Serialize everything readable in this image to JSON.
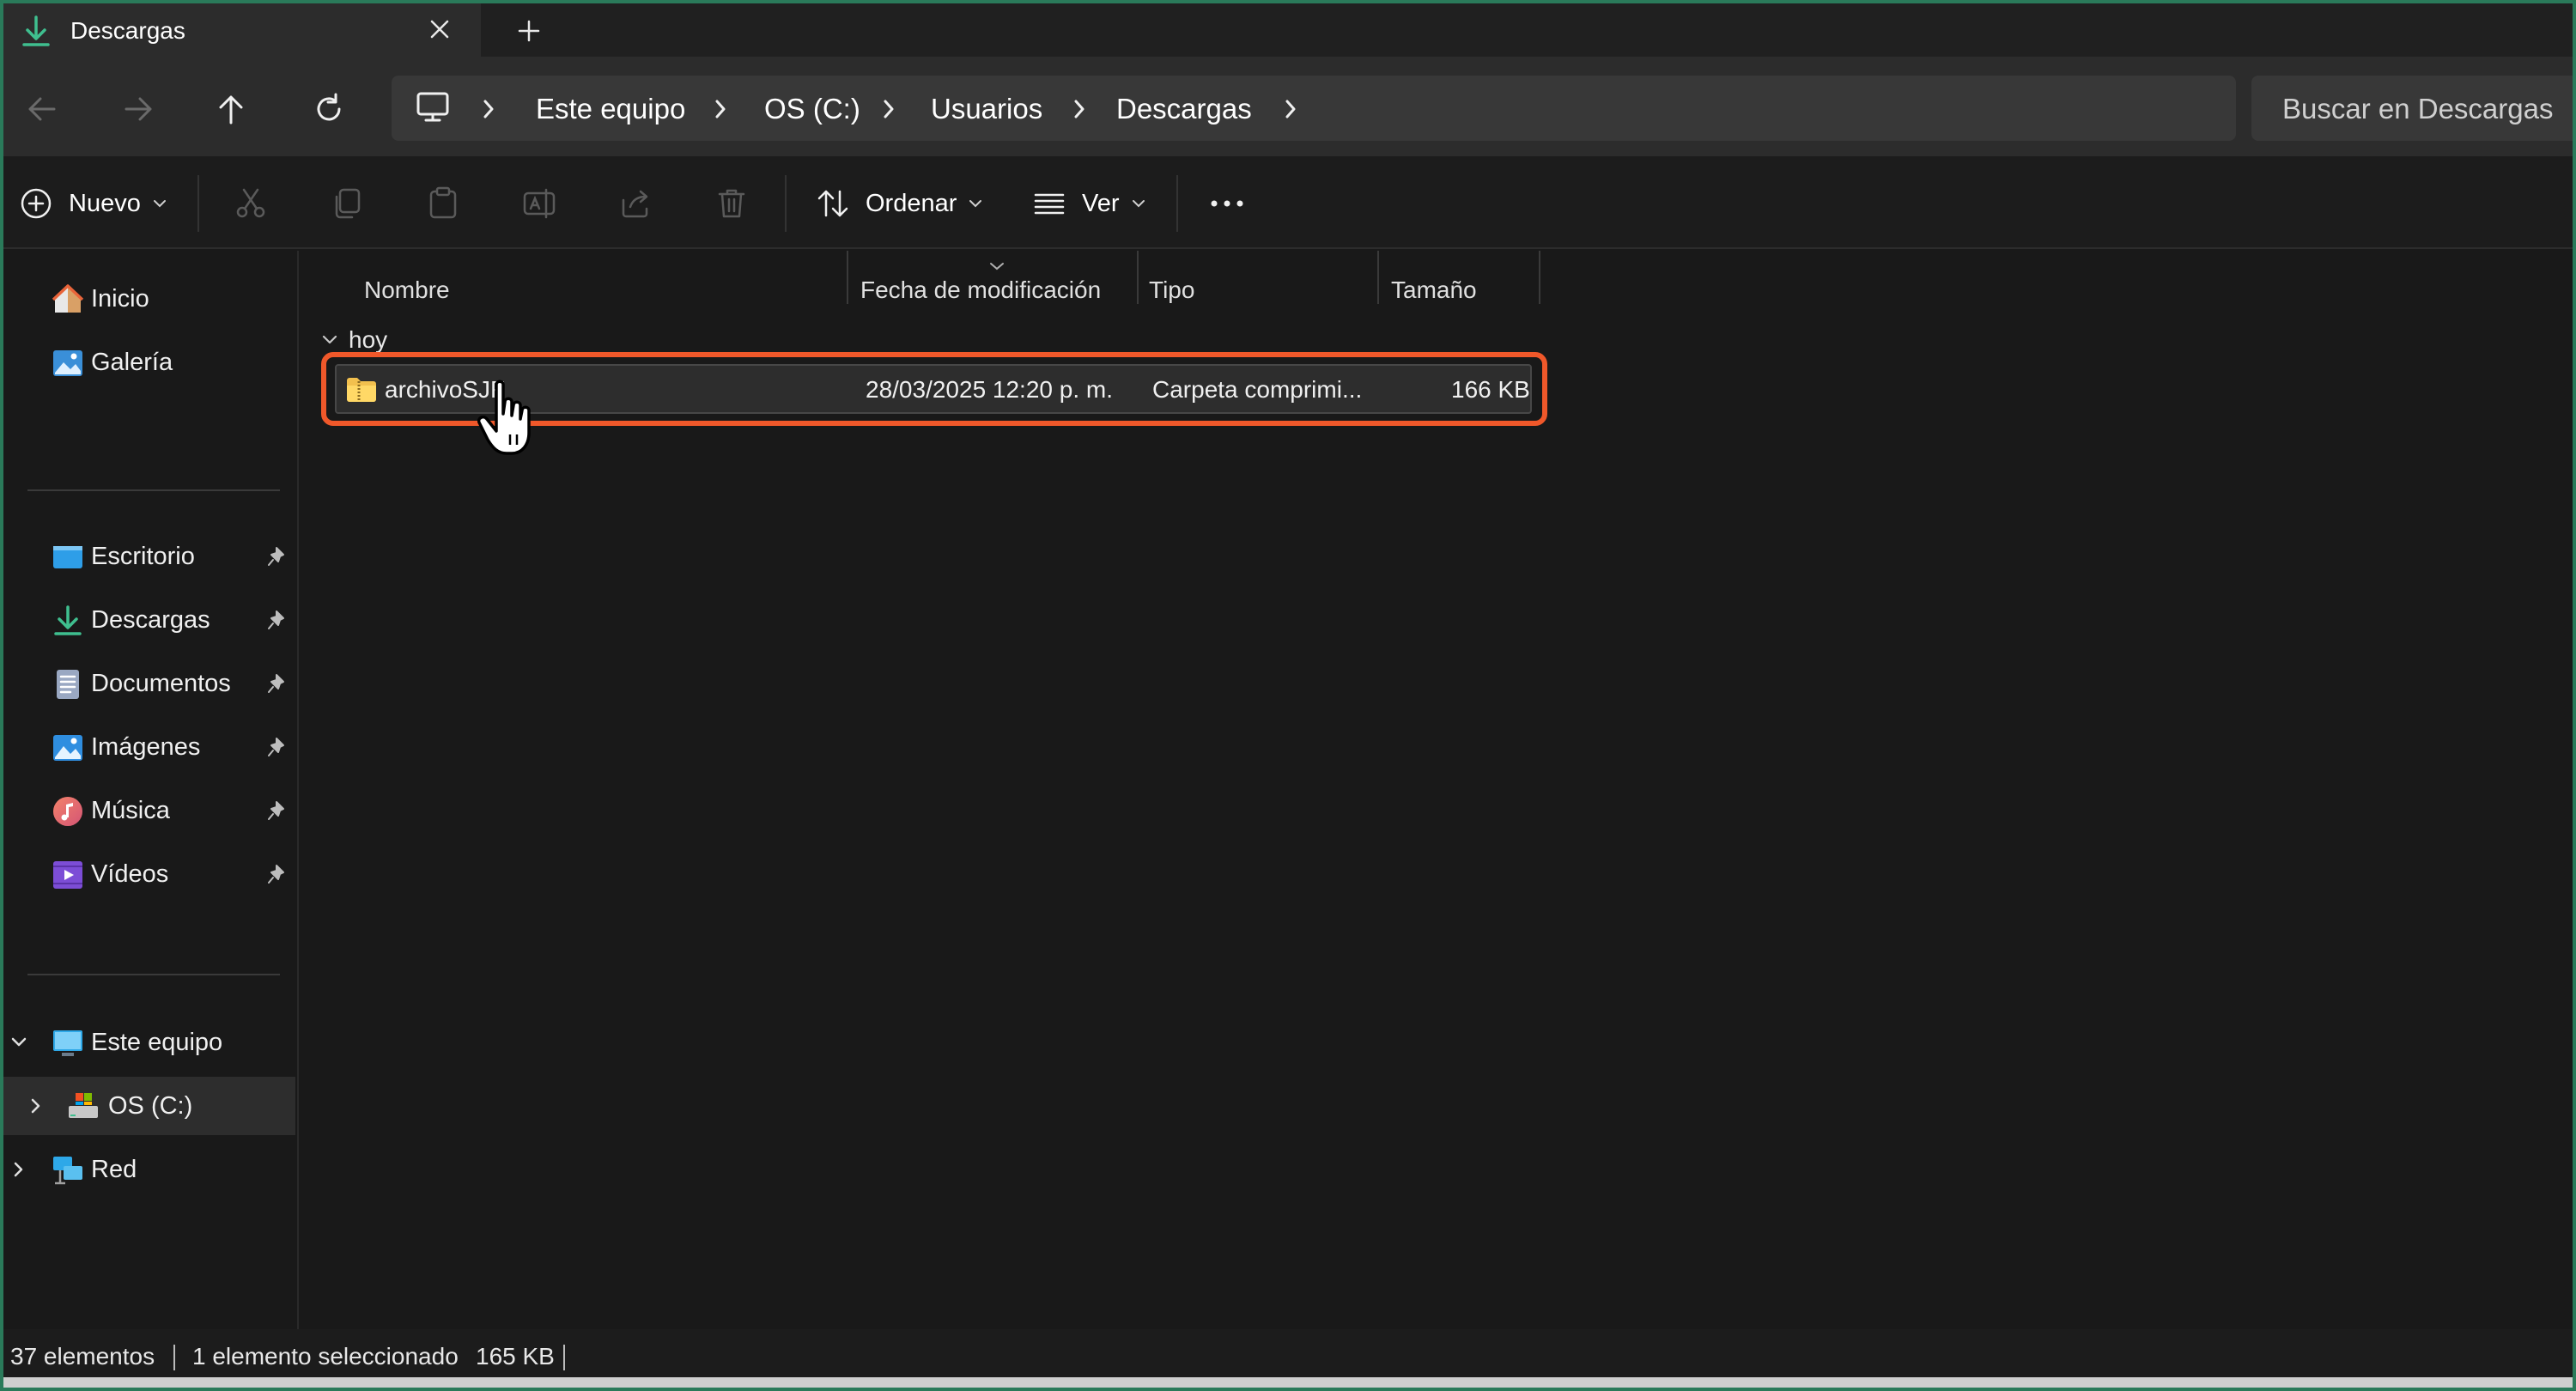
{
  "window": {
    "tab_title": "Descargas",
    "tab_icon": "download-icon"
  },
  "addressbar": {
    "crumbs": [
      "Este equipo",
      "OS (C:)",
      "Usuarios",
      "Descargas"
    ],
    "search_placeholder": "Buscar en Descargas"
  },
  "commandbar": {
    "new_label": "Nuevo",
    "sort_label": "Ordenar",
    "view_label": "Ver"
  },
  "sidebar": {
    "top": [
      {
        "label": "Inicio",
        "icon": "home-icon"
      },
      {
        "label": "Galería",
        "icon": "gallery-icon"
      }
    ],
    "pinned": [
      {
        "label": "Escritorio",
        "icon": "desktop-icon"
      },
      {
        "label": "Descargas",
        "icon": "download-icon"
      },
      {
        "label": "Documentos",
        "icon": "documents-icon"
      },
      {
        "label": "Imágenes",
        "icon": "pictures-icon"
      },
      {
        "label": "Música",
        "icon": "music-icon"
      },
      {
        "label": "Vídeos",
        "icon": "videos-icon"
      }
    ],
    "tree": [
      {
        "label": "Este equipo",
        "icon": "computer-icon"
      },
      {
        "label": "OS (C:)",
        "icon": "drive-icon"
      },
      {
        "label": "Red",
        "icon": "network-icon"
      }
    ]
  },
  "columns": {
    "name": "Nombre",
    "date": "Fecha de modificación",
    "type": "Tipo",
    "size": "Tamaño"
  },
  "group": {
    "label": "hoy"
  },
  "files": [
    {
      "name": "archivoSJF",
      "date": "28/03/2025 12:20 p. m.",
      "type": "Carpeta comprimi...",
      "size": "166 KB"
    }
  ],
  "status": {
    "count": "37 elementos",
    "selection": "1 elemento seleccionado",
    "selected_size": "165 KB"
  },
  "colors": {
    "accent": "#f0582a",
    "background": "#191919",
    "download_green": "#3fbf8f"
  }
}
